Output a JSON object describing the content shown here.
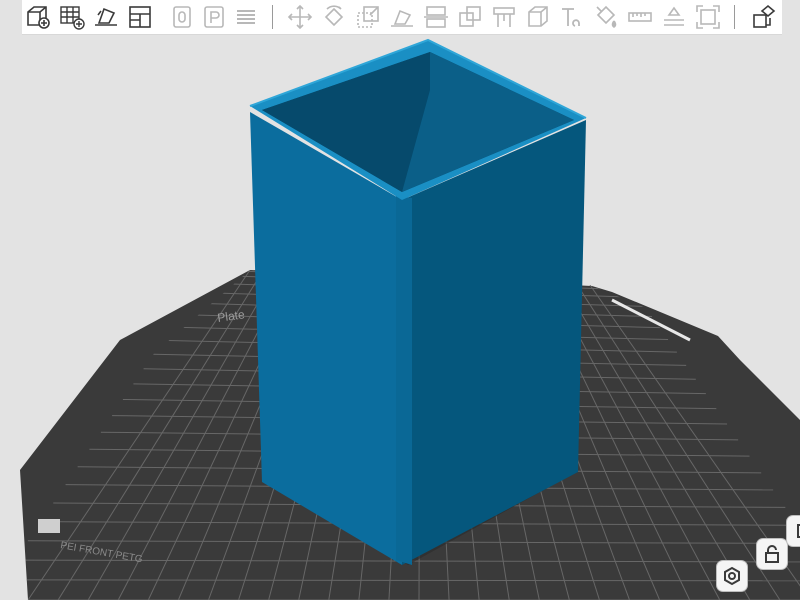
{
  "colors": {
    "toolbar_bg": "#ffffff",
    "icon_dark": "#3a3a3a",
    "icon_disabled": "#b8b8b8",
    "background": "#e3e3e3",
    "model_front": "#05577d",
    "model_left": "#0b6d9e",
    "model_rim": "#1a8fc4",
    "plate": "#3a3a3a",
    "plate_grid": "#6a6a6a"
  },
  "toolbar": {
    "add": "add-object-icon",
    "grid": "arrange-grid-icon",
    "auto_orient": "auto-orient-icon",
    "layout": "layout-icon",
    "copy": "copy-icon",
    "paste": "paste-icon",
    "layers": "layers-icon",
    "move": "move-icon",
    "rotate": "rotate-icon",
    "scale": "scale-icon",
    "lay_on_face": "lay-on-face-icon",
    "cut": "cut-icon",
    "boolean": "boolean-icon",
    "support": "support-paint-icon",
    "seam": "seam-paint-icon",
    "text": "text-shape-icon",
    "paint": "color-paint-icon",
    "measure": "measure-icon",
    "assembly": "assembly-icon",
    "fit": "fit-view-icon",
    "split": "split-icon"
  },
  "plate": {
    "brand": "Plate",
    "label": "PEI FRONT PETG"
  }
}
